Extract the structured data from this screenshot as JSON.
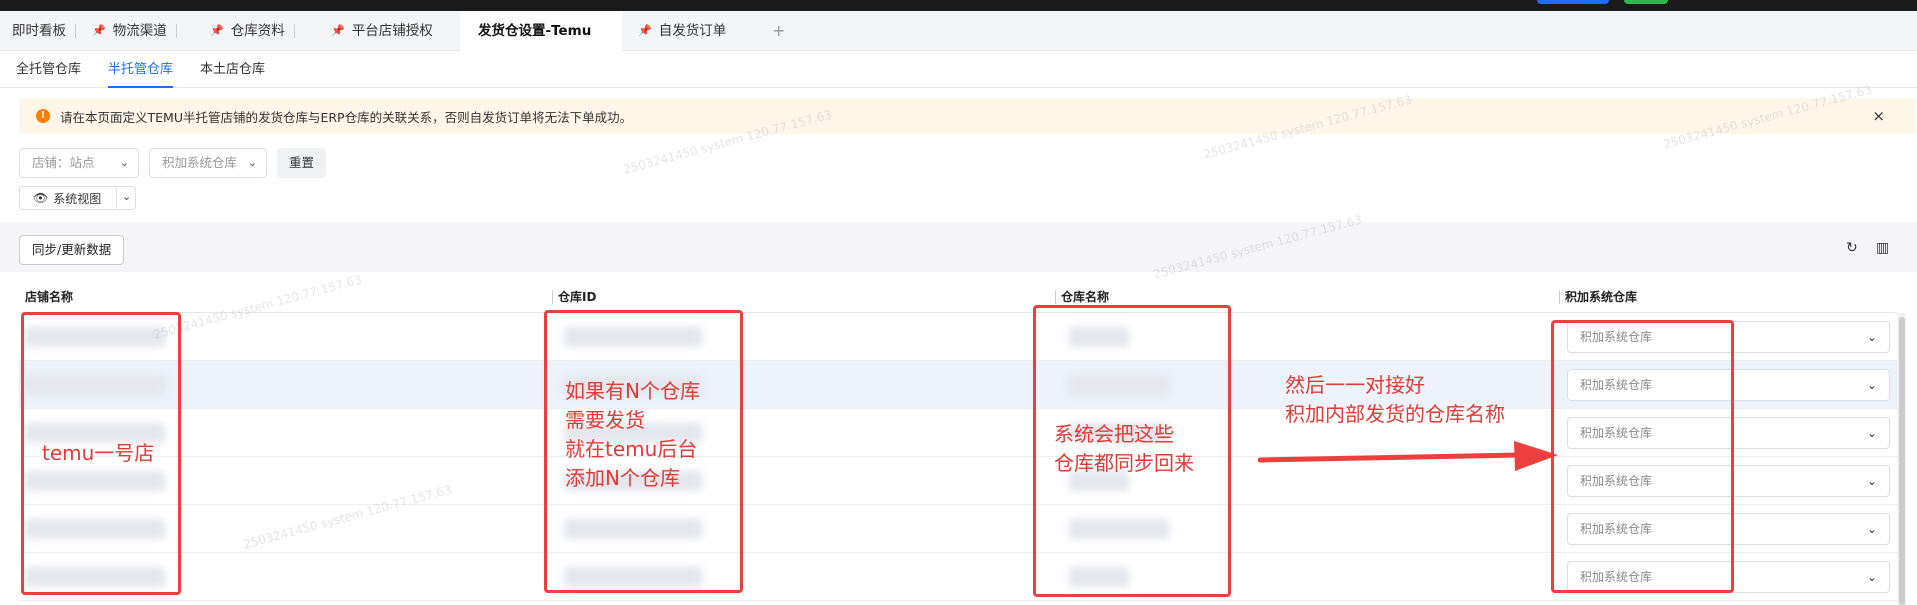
{
  "header": {
    "tabs": [
      {
        "label": "即时看板",
        "pinned": false,
        "active": false
      },
      {
        "label": "物流渠道",
        "pinned": true,
        "active": false
      },
      {
        "label": "仓库资料",
        "pinned": true,
        "active": false
      },
      {
        "label": "平台店铺授权",
        "pinned": true,
        "active": false
      },
      {
        "label": "发货仓设置-Temu",
        "pinned": false,
        "active": true
      },
      {
        "label": "自发货订单",
        "pinned": true,
        "active": false
      }
    ],
    "add_tab_icon": "plus-icon"
  },
  "subtabs": [
    {
      "label": "全托管仓库",
      "active": false
    },
    {
      "label": "半托管仓库",
      "active": true
    },
    {
      "label": "本土店仓库",
      "active": false
    }
  ],
  "alert": {
    "text": "请在本页面定义TEMU半托管店铺的发货仓库与ERP仓库的关联关系，否则自发货订单将无法下单成功。",
    "icon": "!",
    "close": "×"
  },
  "filters": {
    "shop_placeholder": "店铺：站点",
    "warehouse_placeholder": "积加系统仓库",
    "reset_label": "重置",
    "view_label": "系统视图"
  },
  "toolbar": {
    "sync_label": "同步/更新数据",
    "refresh_icon": "↻",
    "columns_icon": "▥"
  },
  "table": {
    "columns": [
      "店铺名称",
      "仓库ID",
      "仓库名称",
      "积加系统仓库"
    ],
    "rows": [
      {
        "select_placeholder": "积加系统仓库"
      },
      {
        "select_placeholder": "积加系统仓库"
      },
      {
        "select_placeholder": "积加系统仓库"
      },
      {
        "select_placeholder": "积加系统仓库"
      },
      {
        "select_placeholder": "积加系统仓库"
      },
      {
        "select_placeholder": "积加系统仓库"
      }
    ]
  },
  "watermark": "2503241450 system 120.77.157.63",
  "annotations": {
    "shop": "temu一号店",
    "warehouse_id": "如果有N个仓库\n需要发货\n就在temu后台\n添加N个仓库",
    "warehouse_name": "系统会把这些\n仓库都同步回来",
    "mapping": "然后一一对接好\n积加内部发货的仓库名称"
  },
  "colors": {
    "accent": "#1e6fff",
    "annotation_red": "#ee3f3f",
    "alert_bg": "#fff5e8",
    "warning_orange": "#ff7d00"
  }
}
